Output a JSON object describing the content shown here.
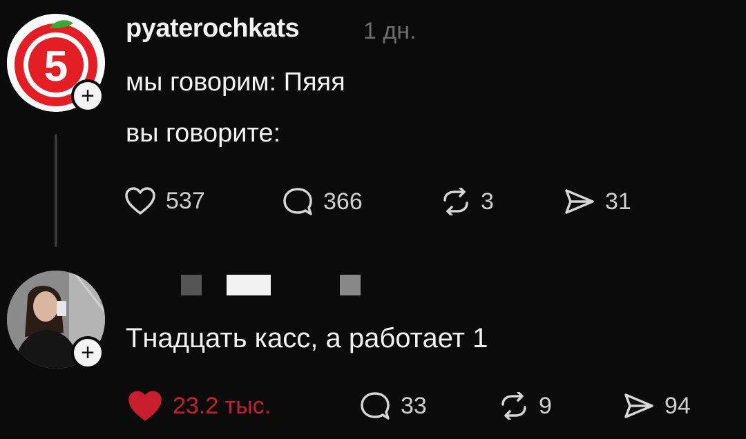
{
  "post": {
    "username": "pyaterochkats",
    "time": "1 дн.",
    "text_line1": "мы говорим: Пяяя",
    "text_line2": "вы говорите:",
    "actions": {
      "likes": "537",
      "comments": "366",
      "reposts": "3",
      "shares": "31"
    },
    "avatar_logo_text": "5"
  },
  "reply": {
    "text": "Тнадцать касс, а работает 1",
    "actions": {
      "likes": "23.2 тыс.",
      "comments": "33",
      "reposts": "9",
      "shares": "94"
    },
    "liked": true
  },
  "colors": {
    "background": "#0b0b0b",
    "like_red": "#c81e2e",
    "logo_red": "#e31e24",
    "logo_green": "#3aa935",
    "muted": "#6e6e6e"
  },
  "icons": [
    "heart-icon",
    "comment-icon",
    "repost-icon",
    "share-icon",
    "plus-icon"
  ]
}
